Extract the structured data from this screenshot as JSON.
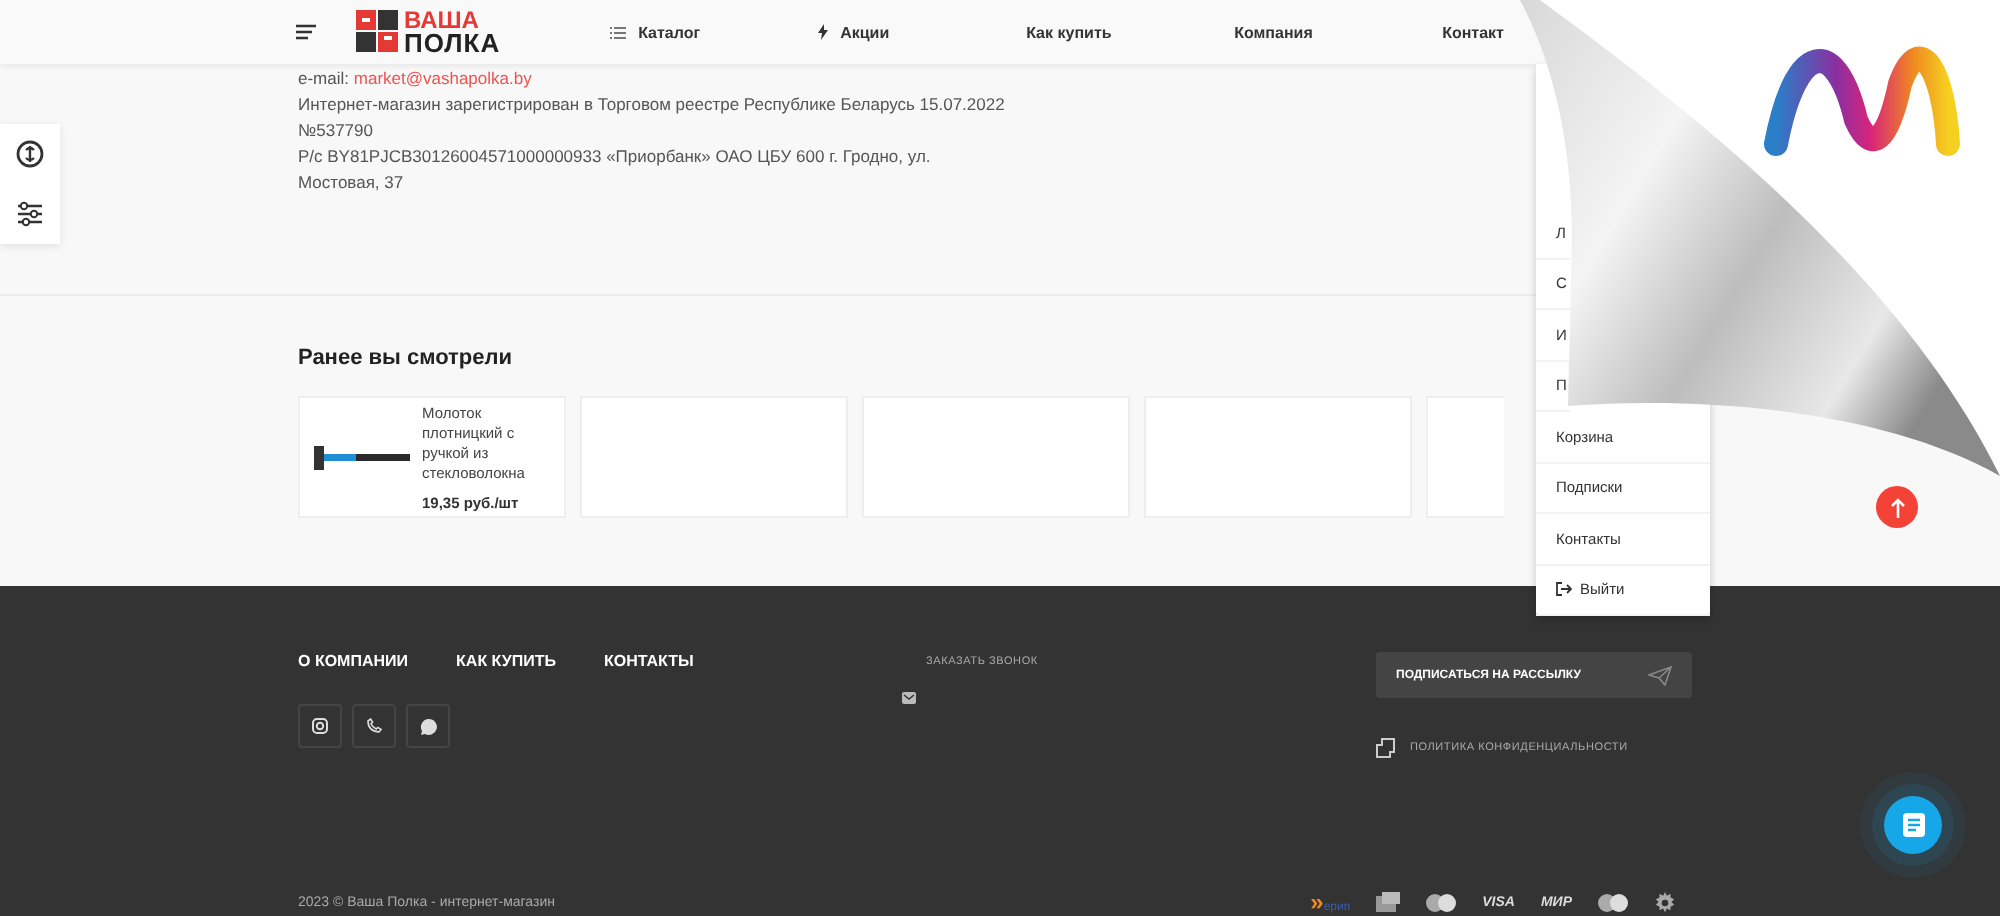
{
  "header": {
    "logo": {
      "top": "ВАША",
      "bottom": "ПОЛКА"
    },
    "nav": [
      {
        "label": "Каталог",
        "kind": "catalog"
      },
      {
        "label": "Акции",
        "kind": "promo"
      },
      {
        "label": "Как купить",
        "kind": "plain"
      },
      {
        "label": "Компания",
        "kind": "plain"
      },
      {
        "label": "Контакт",
        "kind": "plain"
      }
    ]
  },
  "contacts": {
    "email_label": "e-mail:",
    "email": "market@vashapolka.by",
    "lines": [
      "Интернет-магазин зарегистрирован в Торговом реестре Республике Беларусь 15.07.2022",
      "№537790",
      "Р/с BY81PJCB30126004571000000933 «Приорбанк» ОАО ЦБУ 600 г. Гродно, ул.",
      "Мостовая, 37"
    ]
  },
  "viewed": {
    "title": "Ранее вы смотрели",
    "products": [
      {
        "name": "Молоток плотницкий с ручкой из стекловолокна",
        "price": "19,35 руб./шт",
        "kind": "product"
      },
      {
        "kind": "empty"
      },
      {
        "kind": "empty"
      },
      {
        "kind": "empty"
      },
      {
        "kind": "empty"
      }
    ]
  },
  "user_menu": [
    {
      "label": "Л",
      "kind": "hidden"
    },
    {
      "label": "С",
      "kind": "hidden"
    },
    {
      "label": "И",
      "kind": "hidden"
    },
    {
      "label": "П",
      "kind": "hidden"
    },
    {
      "label": "Корзина"
    },
    {
      "label": "Подписки"
    },
    {
      "label": "Контакты"
    },
    {
      "label": "Выйти",
      "kind": "logout"
    }
  ],
  "footer": {
    "nav": [
      "О КОМПАНИИ",
      "КАК КУПИТЬ",
      "КОНТАКТЫ"
    ],
    "callback": "ЗАКАЗАТЬ ЗВОНОК",
    "subscribe": "ПОДПИСАТЬСЯ НА РАССЫЛКУ",
    "policy": "ПОЛИТИКА КОНФИДЕНЦИАЛЬНОСТИ",
    "copyright": "2023 © Ваша Полка - интернет-магазин",
    "payments": [
      {
        "kind": "erip",
        "mark": "»",
        "label": "ерип"
      },
      {
        "kind": "bank"
      },
      {
        "kind": "circles"
      },
      {
        "kind": "text",
        "label": "VISA"
      },
      {
        "kind": "text",
        "label": "МИР"
      },
      {
        "kind": "circles"
      },
      {
        "kind": "gear"
      }
    ]
  }
}
